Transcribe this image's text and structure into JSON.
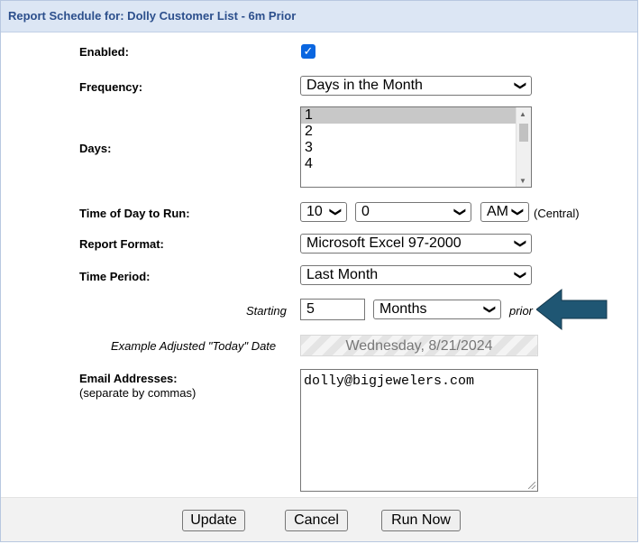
{
  "title": "Report Schedule for: Dolly Customer List - 6m Prior",
  "enabled": {
    "label": "Enabled:",
    "checked": true
  },
  "frequency": {
    "label": "Frequency:",
    "value": "Days in the Month"
  },
  "days": {
    "label": "Days:",
    "options": [
      "1",
      "2",
      "3",
      "4"
    ],
    "selected": "1"
  },
  "time_of_day": {
    "label": "Time of Day to Run:",
    "hour": "10",
    "minute": "0",
    "ampm": "AM",
    "tz": "(Central)"
  },
  "report_format": {
    "label": "Report Format:",
    "value": "Microsoft Excel 97-2000"
  },
  "time_period": {
    "label": "Time Period:",
    "value": "Last Month"
  },
  "starting": {
    "label": "Starting",
    "value": "5",
    "unit": "Months",
    "suffix": "prior"
  },
  "example_date": {
    "label": "Example Adjusted \"Today\" Date",
    "value": "Wednesday, 8/21/2024"
  },
  "email": {
    "label": "Email Addresses:",
    "hint": "(separate by commas)",
    "value": "dolly@bigjewelers.com"
  },
  "buttons": {
    "update": "Update",
    "cancel": "Cancel",
    "run_now": "Run Now"
  },
  "colors": {
    "header_bg": "#dce6f4",
    "header_text": "#2c4f8c",
    "arrow": "#1f5673",
    "checkbox": "#0a66e0"
  }
}
